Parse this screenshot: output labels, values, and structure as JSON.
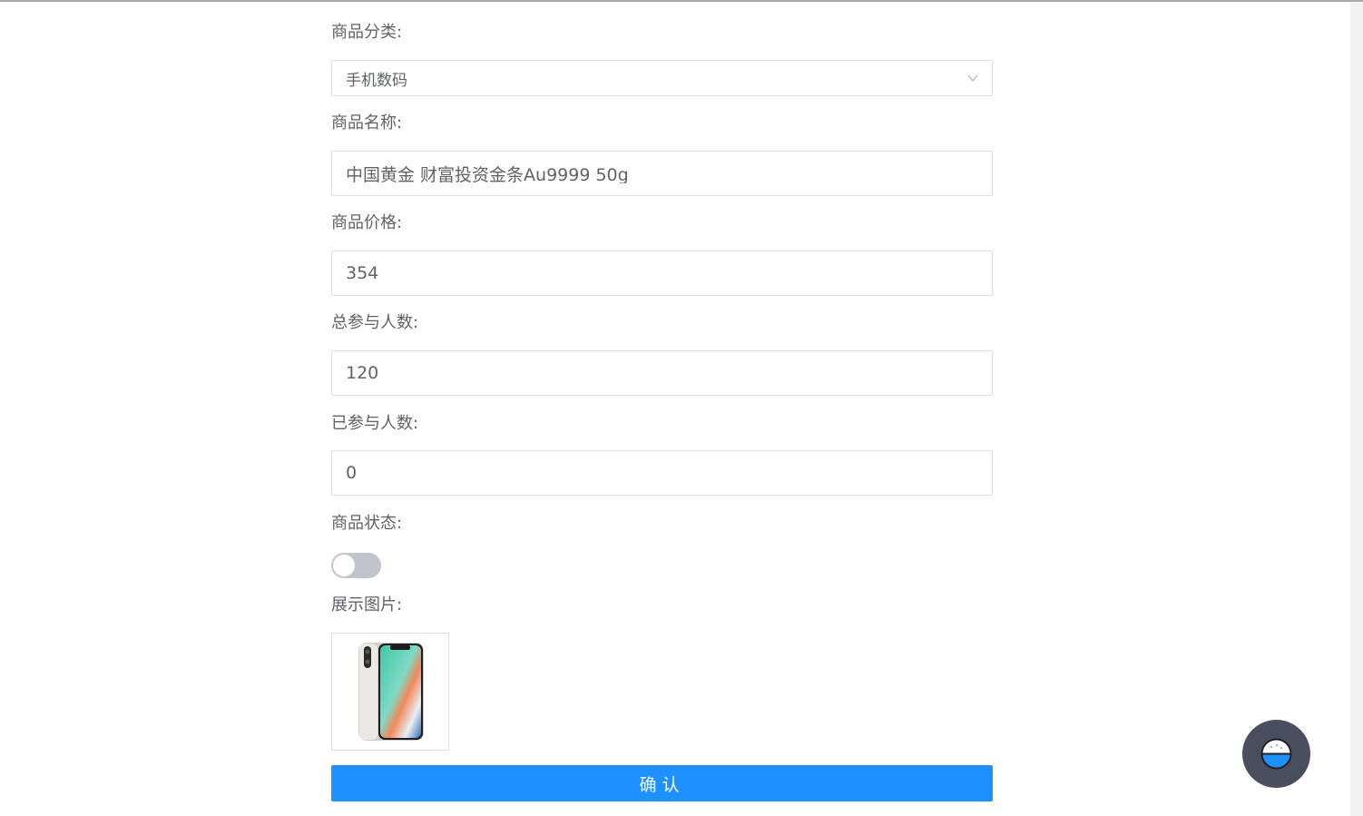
{
  "form": {
    "category": {
      "label": "商品分类:",
      "value": "手机数码"
    },
    "name": {
      "label": "商品名称:",
      "value": "中国黄金 财富投资金条Au9999 50g"
    },
    "price": {
      "label": "商品价格:",
      "value": "354"
    },
    "total_participants": {
      "label": "总参与人数:",
      "value": "120"
    },
    "joined_participants": {
      "label": "已参与人数:",
      "value": "0"
    },
    "status": {
      "label": "商品状态:",
      "enabled": false
    },
    "image": {
      "label": "展示图片:",
      "icon": "smartphone-image"
    },
    "confirm_label": "确认"
  },
  "floating_button": {
    "icon": "rice-bowl-icon"
  },
  "colors": {
    "accent": "#1e90ff",
    "switch_off": "#c0c4cc",
    "fab": "#4b4e5e"
  }
}
